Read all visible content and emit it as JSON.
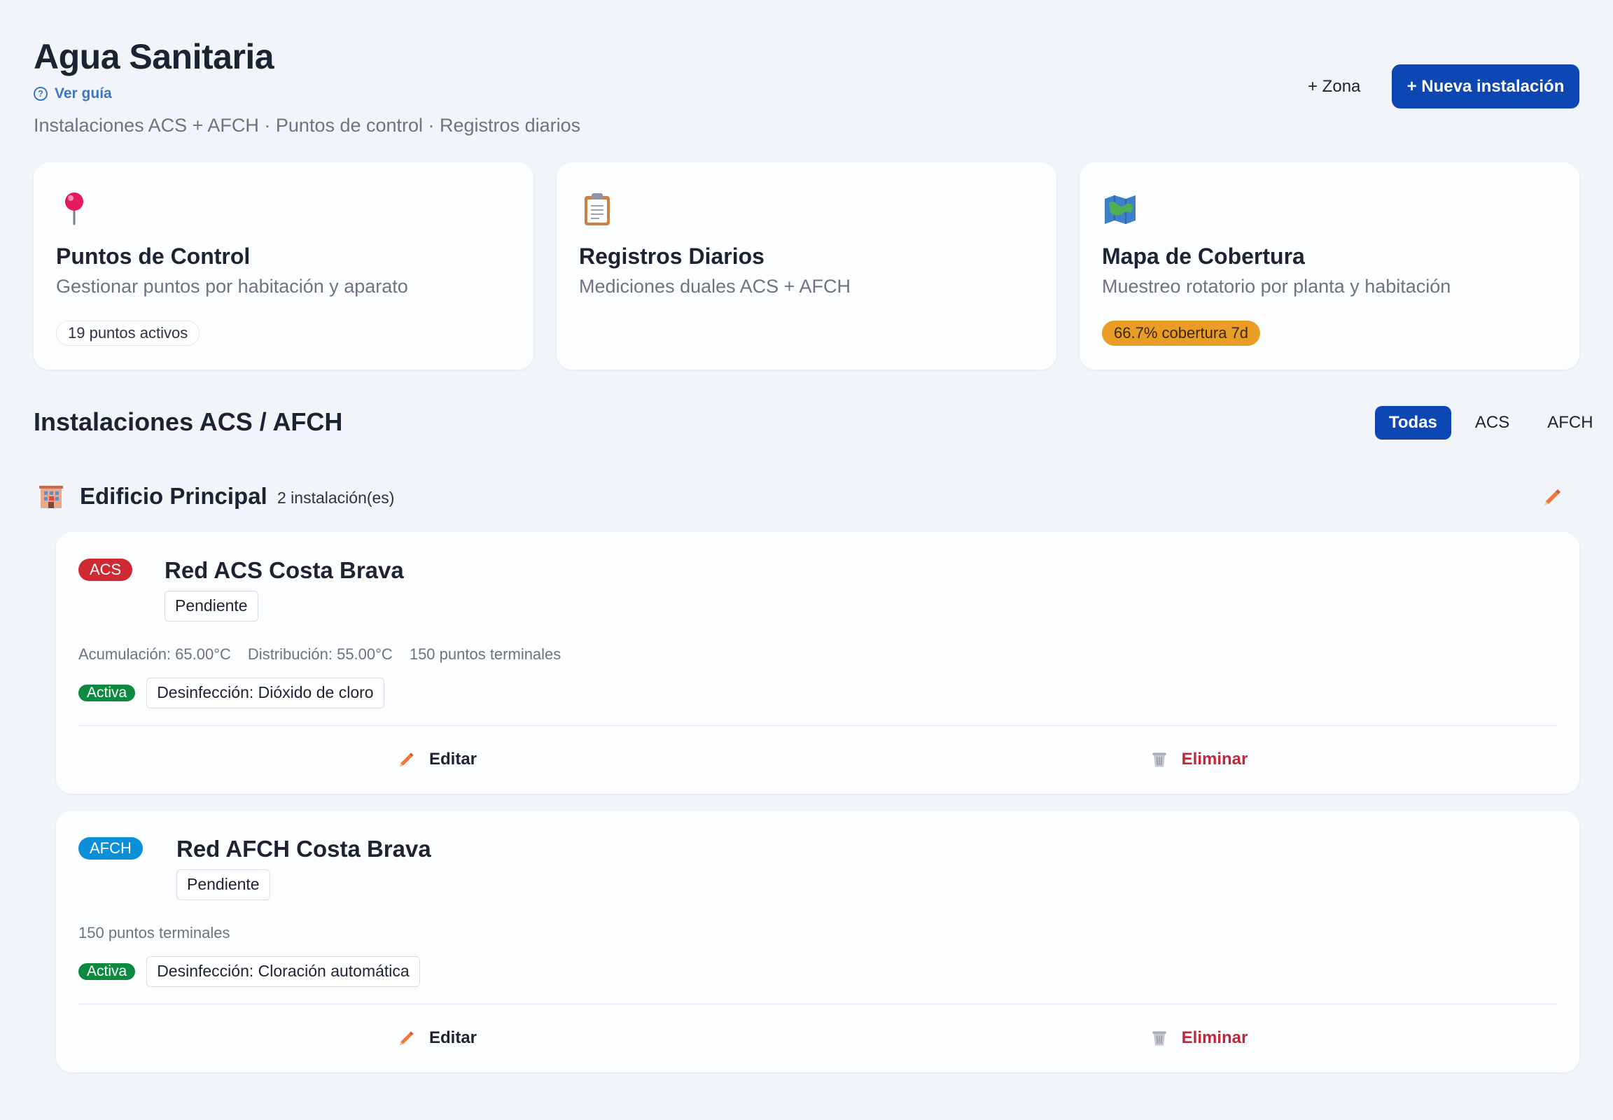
{
  "header": {
    "title": "Agua Sanitaria",
    "guide_label": "Ver guía",
    "subtitle": "Instalaciones ACS + AFCH · Puntos de control · Registros diarios",
    "zone_button": "+ Zona",
    "new_button": "+ Nueva instalación"
  },
  "cards": [
    {
      "title": "Puntos de Control",
      "description": "Gestionar puntos por habitación y aparato",
      "badge": "19 puntos activos",
      "icon": "pushpin-icon"
    },
    {
      "title": "Registros Diarios",
      "description": "Mediciones duales ACS + AFCH",
      "icon": "clipboard-icon"
    },
    {
      "title": "Mapa de Cobertura",
      "description": "Muestreo rotatorio por planta y habitación",
      "badge": "66.7% cobertura 7d",
      "icon": "map-icon"
    }
  ],
  "section": {
    "title": "Instalaciones ACS / AFCH",
    "filters": [
      "Todas",
      "ACS",
      "AFCH"
    ],
    "active_filter": "Todas"
  },
  "group": {
    "name": "Edificio Principal",
    "count": "2 instalación(es)",
    "icon": "building-icon"
  },
  "installations": [
    {
      "type": "ACS",
      "name": "Red ACS Costa Brava",
      "status": "Pendiente",
      "specs": [
        "Acumulación: 65.00°C",
        "Distribución: 55.00°C",
        "150 puntos terminales"
      ],
      "active": "Activa",
      "disinfection": "Desinfección: Dióxido de cloro",
      "edit_label": "Editar",
      "delete_label": "Eliminar"
    },
    {
      "type": "AFCH",
      "name": "Red AFCH Costa Brava",
      "status": "Pendiente",
      "specs": [
        "150 puntos terminales"
      ],
      "active": "Activa",
      "disinfection": "Desinfección: Cloración automática",
      "edit_label": "Editar",
      "delete_label": "Eliminar"
    }
  ],
  "colors": {
    "primary": "#0d47b3",
    "acs": "#cf2a33",
    "afch": "#0b8fd6",
    "active": "#0d8a3f",
    "coverage": "#e99d25",
    "delete": "#c0283a"
  }
}
